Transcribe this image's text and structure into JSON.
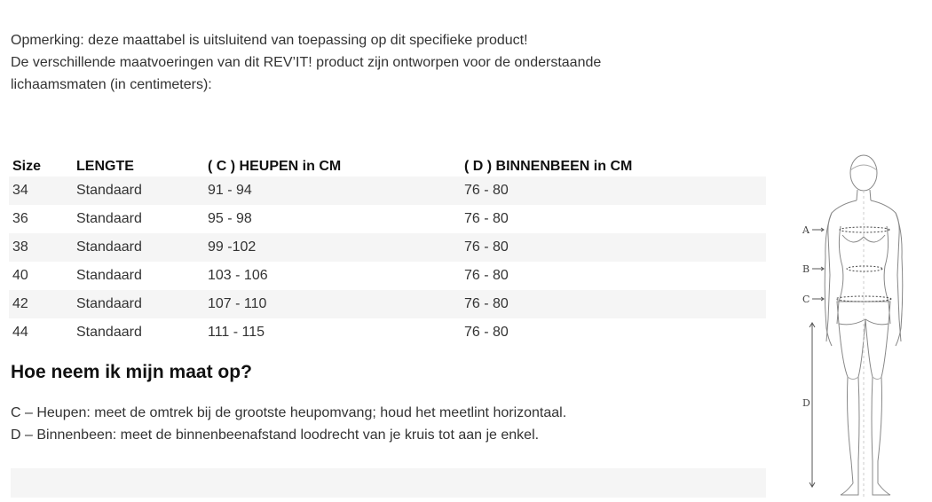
{
  "intro": {
    "line1": "Opmerking: deze maattabel is uitsluitend van toepassing op dit specifieke product!",
    "line2": "De verschillende maatvoeringen van dit REV’IT! product zijn ontworpen voor de onderstaande",
    "line3": "lichaamsmaten (in centimeters):"
  },
  "table": {
    "headers": [
      "Size",
      "LENGTE",
      "( C ) HEUPEN in CM",
      "( D ) BINNENBEEN in CM"
    ],
    "rows": [
      [
        "34",
        "Standaard",
        "91 - 94",
        "76 - 80"
      ],
      [
        "36",
        "Standaard",
        "95 - 98",
        "76 - 80"
      ],
      [
        "38",
        "Standaard",
        "99 -102",
        "76 - 80"
      ],
      [
        "40",
        "Standaard",
        "103 - 106",
        "76 - 80"
      ],
      [
        "42",
        "Standaard",
        "107 - 110",
        "76 - 80"
      ],
      [
        "44",
        "Standaard",
        "111 - 115",
        "76 - 80"
      ]
    ]
  },
  "howto": {
    "title": "Hoe neem ik mijn maat op?",
    "line_c": "C – Heupen: meet de omtrek bij de grootste heupomvang; houd het meetlint horizontaal.",
    "line_d": "D – Binnenbeen: meet de binnenbeenafstand loodrecht van je kruis tot aan je enkel."
  },
  "figure": {
    "label_a": "A",
    "label_b": "B",
    "label_c": "C",
    "label_d": "D"
  },
  "colors": {
    "row_stripe": "#f5f5f5",
    "text": "#333333",
    "figure_line": "#888888"
  }
}
